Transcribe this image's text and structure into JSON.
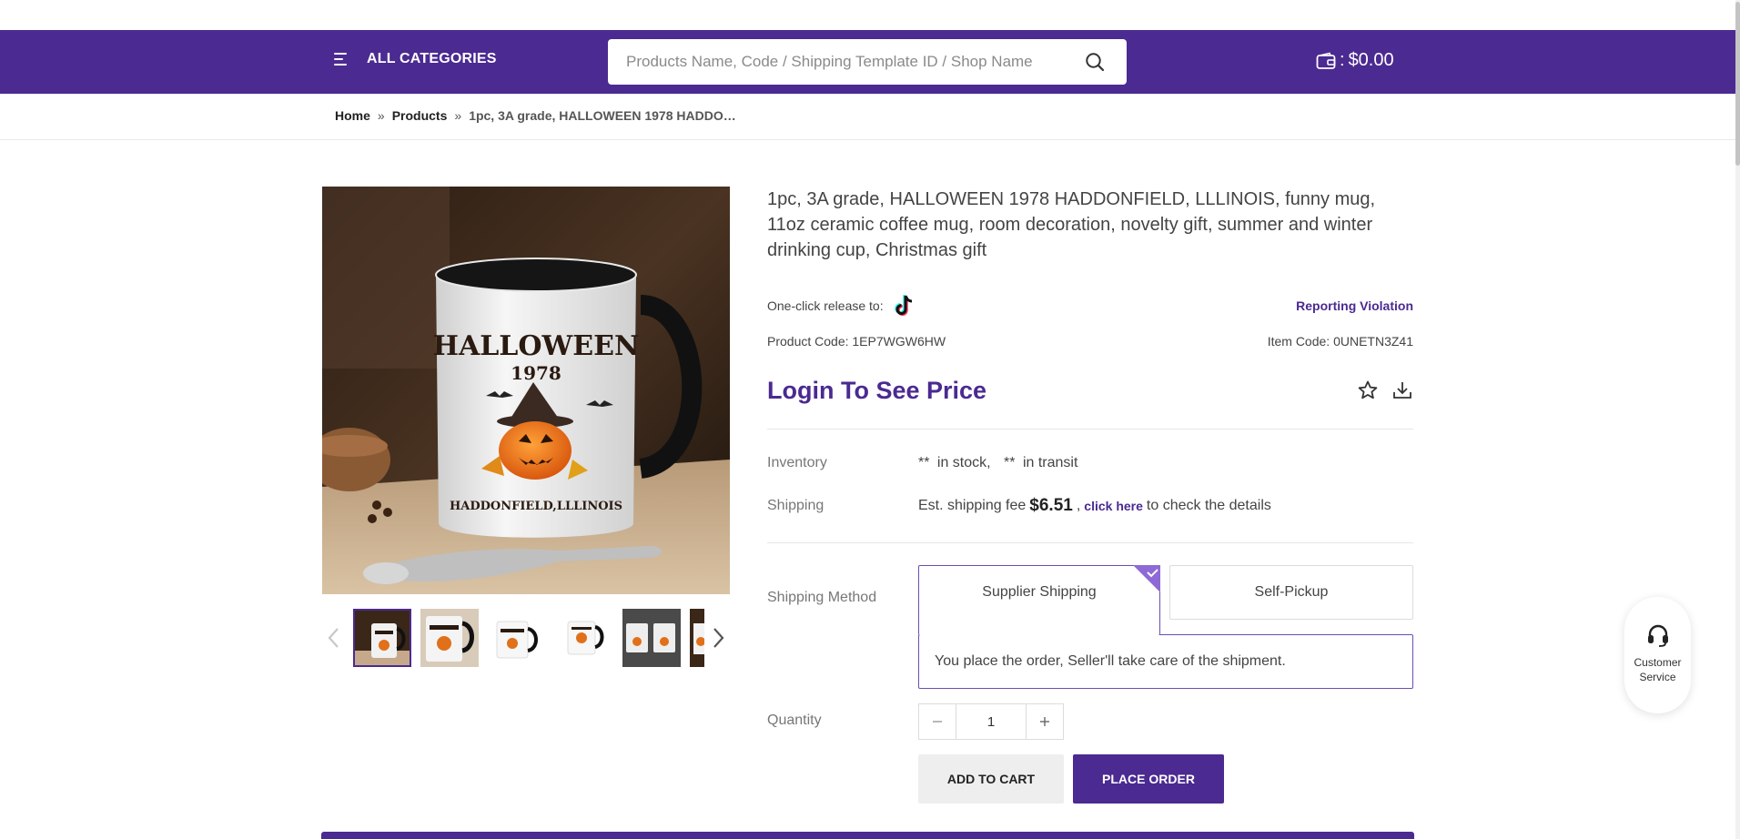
{
  "header": {
    "categories_label": "ALL CATEGORIES",
    "search_placeholder": "Products Name, Code / Shipping Template ID / Shop Name",
    "wallet_separator": ":",
    "wallet_balance": "$0.00"
  },
  "breadcrumb": {
    "home": "Home",
    "products": "Products",
    "current": "1pc, 3A grade, HALLOWEEN 1978 HADDON..."
  },
  "product": {
    "title": "1pc, 3A grade, HALLOWEEN 1978 HADDONFIELD, LLLINOIS, funny mug, 11oz ceramic coffee mug, room decoration, novelty gift, summer and winter drinking cup, Christmas gift",
    "release_label": "One-click release to:",
    "report_label": "Reporting Violation",
    "product_code_label": "Product Code:",
    "product_code": "1EP7WGW6HW",
    "item_code_label": "Item Code:",
    "item_code": "0UNETN3Z41",
    "price_label": "Login To See Price",
    "mug_text_top": "HALLOWEEN",
    "mug_text_year": "1978",
    "mug_text_bottom": "HADDONFIELD,LLLINOIS"
  },
  "inventory": {
    "label": "Inventory",
    "stock_value": "**",
    "stock_text": "in stock,",
    "transit_value": "**",
    "transit_text": "in transit"
  },
  "shipping": {
    "label": "Shipping",
    "prefix": "Est. shipping fee",
    "fee": "$6.51",
    "comma": ",",
    "link": "click here",
    "suffix": "to check the details"
  },
  "shipping_method": {
    "label": "Shipping Method",
    "options": [
      "Supplier Shipping",
      "Self-Pickup"
    ],
    "selected": "Supplier Shipping",
    "description": "You place the order, Seller'll take care of the shipment."
  },
  "quantity": {
    "label": "Quantity",
    "value": "1"
  },
  "buttons": {
    "add_to_cart": "ADD TO CART",
    "place_order": "PLACE ORDER"
  },
  "customer_service": {
    "label": "Customer Service"
  },
  "icons": {
    "menu": "menu-icon",
    "search": "search-icon",
    "wallet": "wallet-icon",
    "tiktok": "tiktok-icon",
    "favorite": "star-icon",
    "download": "download-icon",
    "headset": "headset-icon"
  },
  "colors": {
    "brand": "#4b2a91",
    "accent": "#6b4fb3"
  }
}
